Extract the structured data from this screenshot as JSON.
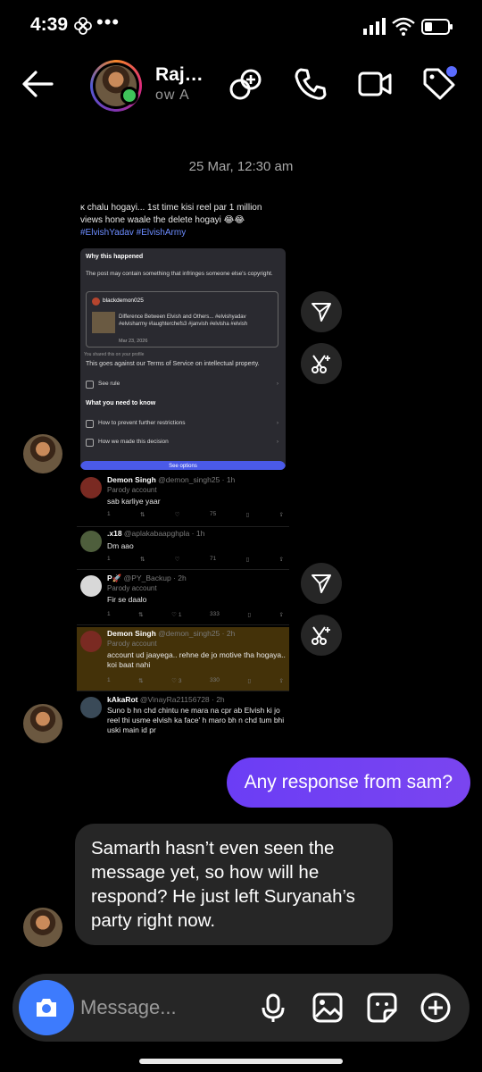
{
  "status_bar": {
    "time": "4:39",
    "dots": "•••"
  },
  "header": {
    "name": "Raj…",
    "subtitle": "ow  A"
  },
  "date_separator": "25 Mar, 12:30 am",
  "shared_post": {
    "caption": "ĸ chalu hogayi... 1st time kisi reel par 1 million views hone waale the delete hogayi 😂😂",
    "hashtags": "#ElvishYadav #ElvishArmy",
    "ig_card": {
      "title": "Why this happened",
      "body": "The post may contain something that infringes someone else's copyright.",
      "username": "blackdemon025",
      "post_text": "Difference Between Elvish and Others... #elvishyadav #elvisharmy #laughterchefs3 #janvish #elvisha #elvish",
      "post_date": "Mar 23, 2026",
      "shared_note": "You shared this on your profile",
      "policy": "This goes against our Terms of Service on intellectual property.",
      "see_rule": "See rule",
      "need_to_know": "What you need to know",
      "prevent": "How to prevent further restrictions",
      "decision": "How we made this decision",
      "see_options": "See options"
    },
    "tweets": [
      {
        "name": "Demon Singh",
        "handle": "@demon_singh25 · 1h",
        "parody": "Parody account",
        "text": "sab karliye yaar",
        "stats": [
          "1",
          "",
          "",
          "75",
          "",
          ""
        ]
      },
      {
        "name": ".x18",
        "handle": "@aplakabaapghpla · 1h",
        "parody": "",
        "text": "Dm aao",
        "stats": [
          "1",
          "",
          "",
          "71",
          "",
          ""
        ]
      },
      {
        "name": "P🚀",
        "handle": "@PY_Backup · 2h",
        "parody": "Parody account",
        "text": "Fir se daalo",
        "stats": [
          "1",
          "",
          "1",
          "333",
          "",
          ""
        ]
      },
      {
        "name": "Demon Singh",
        "handle": "@demon_singh25 · 2h",
        "parody": "Parody account",
        "text": "account ud jaayega.. rehne de jo motive tha hogaya.. koi baat nahi",
        "stats": [
          "1",
          "",
          "3",
          "330",
          "",
          ""
        ]
      },
      {
        "name": "kAkaRot",
        "handle": "@VinayRa21156728 · 2h",
        "parody": "",
        "text": "Suno b hn chd chintu ne mara na cpr ab Elvish ki jo reel thi usme elvish ka face' h maro bh n chd tum bhi uski main id pr",
        "stats": []
      }
    ]
  },
  "messages": {
    "outgoing": "Any response from sam?",
    "incoming": "Samarth hasn’t even seen the message yet, so how will he respond? He just left Suryanah’s party right now."
  },
  "composer": {
    "placeholder": "Message..."
  },
  "colors": {
    "accent": "#3d7bfd",
    "bubble_out": "#6b3df5",
    "bubble_in": "#262626",
    "online": "#3fc35a"
  }
}
